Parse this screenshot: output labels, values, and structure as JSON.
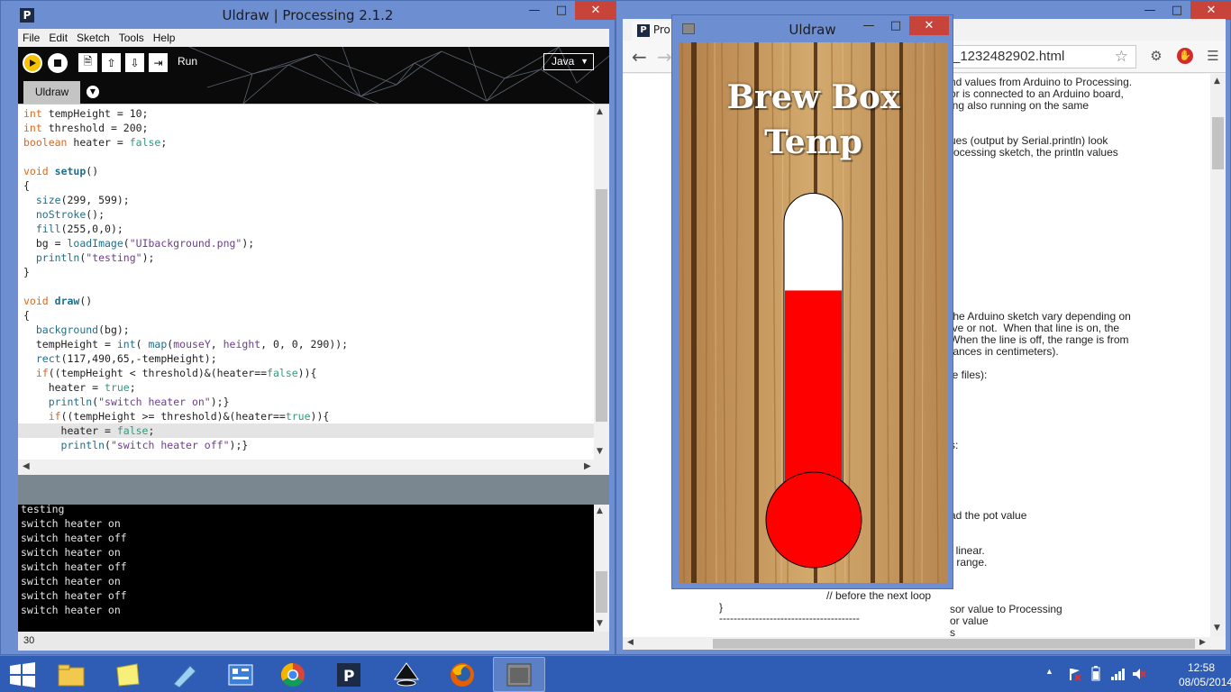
{
  "ide": {
    "title": "Uldraw | Processing 2.1.2",
    "app_icon_letter": "P",
    "menu": [
      "File",
      "Edit",
      "Sketch",
      "Tools",
      "Help"
    ],
    "toolbar": {
      "run_label": "Run",
      "mode": "Java"
    },
    "tab": "Uldraw",
    "code_lines": [
      [
        [
          "kw",
          "int"
        ],
        [
          "t",
          " tempHeight = 10;"
        ]
      ],
      [
        [
          "kw",
          "int"
        ],
        [
          "t",
          " threshold = 200;"
        ]
      ],
      [
        [
          "kw",
          "boolean"
        ],
        [
          "t",
          " heater = "
        ],
        [
          "lit",
          "false"
        ],
        [
          "t",
          ";"
        ]
      ],
      [],
      [
        [
          "kw",
          "void"
        ],
        [
          "t",
          " "
        ],
        [
          "fnb",
          "setup"
        ],
        [
          "t",
          "()"
        ]
      ],
      [
        [
          "t",
          "{"
        ]
      ],
      [
        [
          "t",
          "  "
        ],
        [
          "fn",
          "size"
        ],
        [
          "t",
          "(299, 599);"
        ]
      ],
      [
        [
          "t",
          "  "
        ],
        [
          "fn",
          "noStroke"
        ],
        [
          "t",
          "();"
        ]
      ],
      [
        [
          "t",
          "  "
        ],
        [
          "fn",
          "fill"
        ],
        [
          "t",
          "(255,0,0);"
        ]
      ],
      [
        [
          "t",
          "  bg = "
        ],
        [
          "fn",
          "loadImage"
        ],
        [
          "t",
          "("
        ],
        [
          "str",
          "\"UIbackground.png\""
        ],
        [
          "t",
          ");"
        ]
      ],
      [
        [
          "t",
          "  "
        ],
        [
          "fn",
          "println"
        ],
        [
          "t",
          "("
        ],
        [
          "str",
          "\"testing\""
        ],
        [
          "t",
          ");"
        ]
      ],
      [
        [
          "t",
          "}"
        ]
      ],
      [],
      [
        [
          "kw",
          "void"
        ],
        [
          "t",
          " "
        ],
        [
          "fnb",
          "draw"
        ],
        [
          "t",
          "()"
        ]
      ],
      [
        [
          "t",
          "{"
        ]
      ],
      [
        [
          "t",
          "  "
        ],
        [
          "fn",
          "background"
        ],
        [
          "t",
          "(bg);"
        ]
      ],
      [
        [
          "t",
          "  tempHeight = "
        ],
        [
          "fn",
          "int"
        ],
        [
          "t",
          "( "
        ],
        [
          "fn",
          "map"
        ],
        [
          "t",
          "("
        ],
        [
          "str",
          "mouseY"
        ],
        [
          "t",
          ", "
        ],
        [
          "str",
          "height"
        ],
        [
          "t",
          ", 0, 0, 290));"
        ]
      ],
      [
        [
          "t",
          "  "
        ],
        [
          "fn",
          "rect"
        ],
        [
          "t",
          "(117,490,65,-tempHeight);"
        ]
      ],
      [
        [
          "t",
          "  "
        ],
        [
          "kw",
          "if"
        ],
        [
          "t",
          "((tempHeight < threshold)&(heater=="
        ],
        [
          "lit",
          "false"
        ],
        [
          "t",
          "))"
        ],
        [
          "t",
          "{"
        ]
      ],
      [
        [
          "t",
          "    heater = "
        ],
        [
          "lit",
          "true"
        ],
        [
          "t",
          ";"
        ]
      ],
      [
        [
          "t",
          "    "
        ],
        [
          "fn",
          "println"
        ],
        [
          "t",
          "("
        ],
        [
          "str",
          "\"switch heater on\""
        ],
        [
          "t",
          ");}"
        ]
      ],
      [
        [
          "t",
          "    "
        ],
        [
          "kw",
          "if"
        ],
        [
          "t",
          "((tempHeight >= threshold)&(heater=="
        ],
        [
          "lit",
          "true"
        ],
        [
          "t",
          "))"
        ],
        [
          "t",
          "{"
        ]
      ],
      [
        [
          "t",
          "      heater = "
        ],
        [
          "lit",
          "false"
        ],
        [
          "t",
          ";"
        ]
      ],
      [
        [
          "t",
          "      "
        ],
        [
          "fn",
          "println"
        ],
        [
          "t",
          "("
        ],
        [
          "str",
          "\"switch heater off\""
        ],
        [
          "t",
          ");}"
        ]
      ]
    ],
    "highlighted_line": 22,
    "console_lines": [
      "testing",
      "switch heater on",
      "switch heater off",
      "switch heater on",
      "switch heater off",
      "switch heater on",
      "switch heater off",
      "switch heater on"
    ],
    "status_line_number": "30"
  },
  "browser": {
    "tab_label": "Pro",
    "url_fragment": "_1232482902.html",
    "page_lines": [
      "nd values from Arduino to Processing.",
      "or is connected to an Arduino board,",
      "ing also running on the same",
      "",
      "",
      "ues (output by Serial.println) look",
      "rocessing sketch, the println values",
      "",
      "",
      "",
      "",
      "",
      "",
      "",
      "",
      "",
      "",
      "",
      "",
      "",
      "the Arduino sketch vary depending on",
      "ive or not.  When that line is on, the",
      "When the line is off, the range is from",
      "tances in centimeters).",
      "",
      "le files):",
      "",
      "",
      "",
      "",
      "",
      "s:",
      "",
      "",
      "",
      "",
      "",
      "ad the pot value",
      "",
      "",
      "t linear.",
      "r range.",
      "",
      "",
      "",
      "sor value to Processing",
      "or value",
      "s"
    ],
    "page_footer_comment": "// before the next loop",
    "page_brace": "}",
    "page_rule": "---------------------------------------"
  },
  "sketch": {
    "title": "Uldraw",
    "heading_line1": "Brew Box",
    "heading_line2": "Temp",
    "temperature_fill_fraction": 0.74,
    "colors": {
      "mercury": "#ff0000",
      "tube": "#ffffff",
      "wood": "#c79a5e"
    }
  },
  "taskbar": {
    "apps": [
      "file-explorer",
      "sticky-notes",
      "pen-app",
      "control-panel",
      "chrome",
      "processing",
      "inkscape",
      "firefox",
      "sketch-window"
    ],
    "time": "12:58",
    "date": "08/05/2014"
  }
}
